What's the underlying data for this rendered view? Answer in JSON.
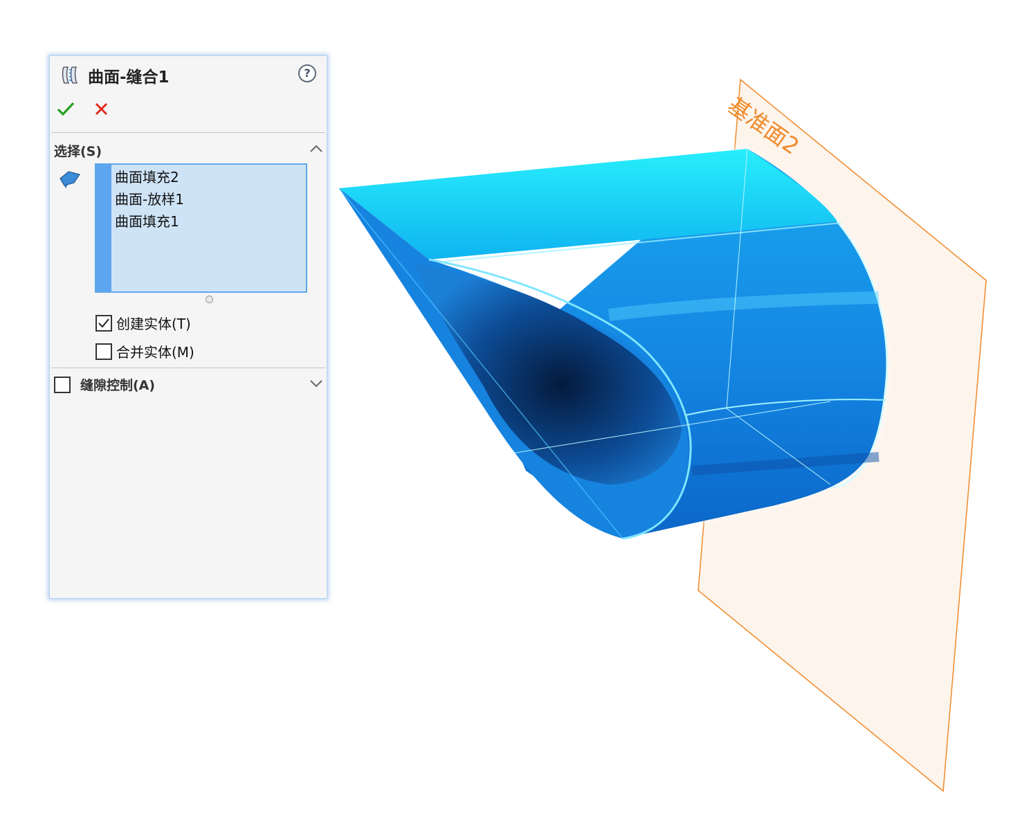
{
  "property_manager": {
    "title": "曲面-缝合1",
    "help_label": "?",
    "ok_icon": "checkmark-icon",
    "cancel_icon": "x-icon",
    "selection_section": {
      "label": "选择(S)",
      "icon": "surface-select-icon",
      "items": [
        "曲面填充2",
        "曲面-放样1",
        "曲面填充1"
      ]
    },
    "options": [
      {
        "label": "创建实体(T)",
        "checked": true
      },
      {
        "label": "合并实体(M)",
        "checked": false
      }
    ],
    "gap_section": {
      "label": "缝隙控制(A)",
      "checked": false
    }
  },
  "viewport": {
    "plane_label": "基准面2",
    "colors": {
      "body_highlight": "#22e6f8",
      "body_main": "#1a8fe6",
      "body_dark": "#0a3f86",
      "plane_edge": "#f08a2a",
      "plane_fill": "#fdf3ea"
    }
  }
}
